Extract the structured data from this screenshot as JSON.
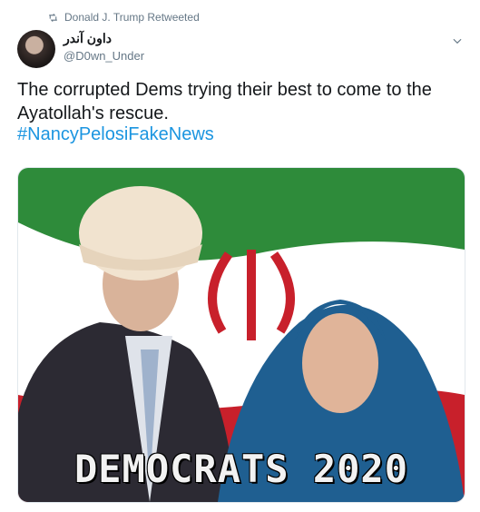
{
  "retweet": {
    "text": "Donald J. Trump Retweeted",
    "icon": "retweet-icon"
  },
  "author": {
    "name": "داون آندر",
    "handle": "@D0wn_Under"
  },
  "tweet": {
    "text": "The corrupted Dems trying their best to come to the Ayatollah's rescue.",
    "hashtag": "#NancyPelosiFakeNews"
  },
  "media": {
    "caption": "DEMOCRATS 2020"
  },
  "colors": {
    "link": "#1b95e0",
    "muted": "#657786",
    "flag_green": "#2e8b3a",
    "flag_red": "#c8202b"
  }
}
